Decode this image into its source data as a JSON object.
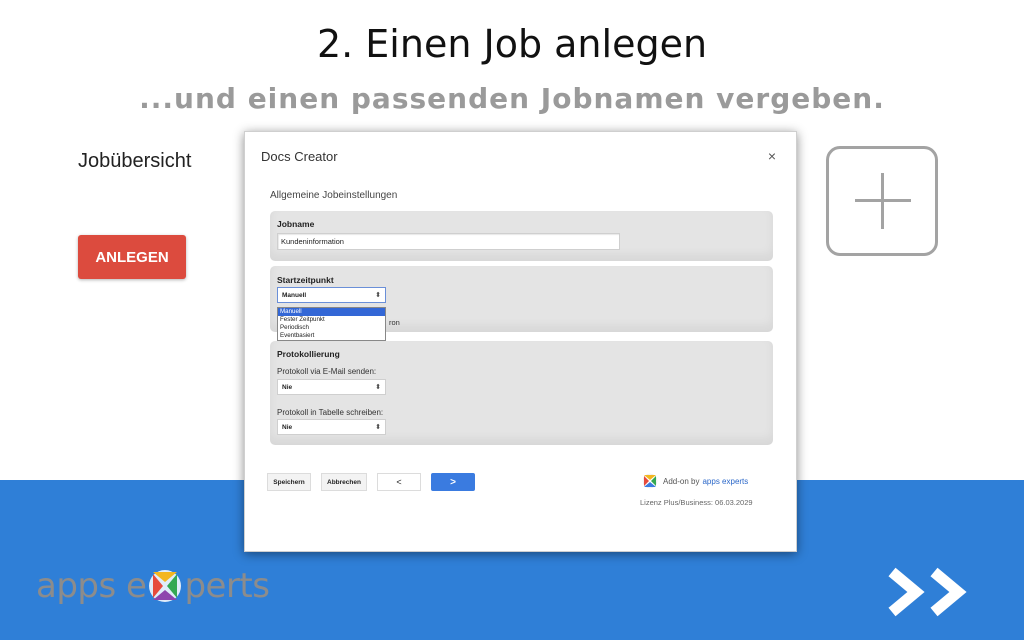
{
  "slide": {
    "title": "2. Einen Job anlegen",
    "subtitle": "...und einen passenden Jobnamen vergeben."
  },
  "background_app": {
    "overview_label": "Jobübersicht",
    "create_button": "ANLEGEN",
    "create_button_color": "#dc4b3e"
  },
  "dialog": {
    "title": "Docs Creator",
    "close_symbol": "×",
    "section_heading": "Allgemeine Jobeinstellungen",
    "jobname": {
      "label": "Jobname",
      "value": "Kundeninformation"
    },
    "start": {
      "label": "Startzeitpunkt",
      "selected": "Manuell",
      "options": [
        "Manuell",
        "Fester Zeitpunkt",
        "Periodisch",
        "Eventbasiert"
      ],
      "partial_text": "ron"
    },
    "logging": {
      "label": "Protokollierung",
      "email_label": "Protokoll via E-Mail senden:",
      "email_value": "Nie",
      "sheet_label": "Protokoll in Tabelle schreiben:",
      "sheet_value": "Nie"
    },
    "buttons": {
      "save": "Speichern",
      "cancel": "Abbrechen",
      "prev": "<",
      "next": ">"
    },
    "addon_text": "Add-on by",
    "addon_link": "apps experts",
    "license": "Lizenz Plus/Business: 06.03.2029"
  },
  "brand": {
    "logo_part1": "apps e",
    "logo_part2": "perts",
    "band_color": "#2f7fd7",
    "accent_color": "#3a7be0"
  },
  "icons": {
    "plus": "plus-icon",
    "next_slide": "double-chevron-right-icon",
    "addon_logo": "apps-experts-logo-icon"
  }
}
